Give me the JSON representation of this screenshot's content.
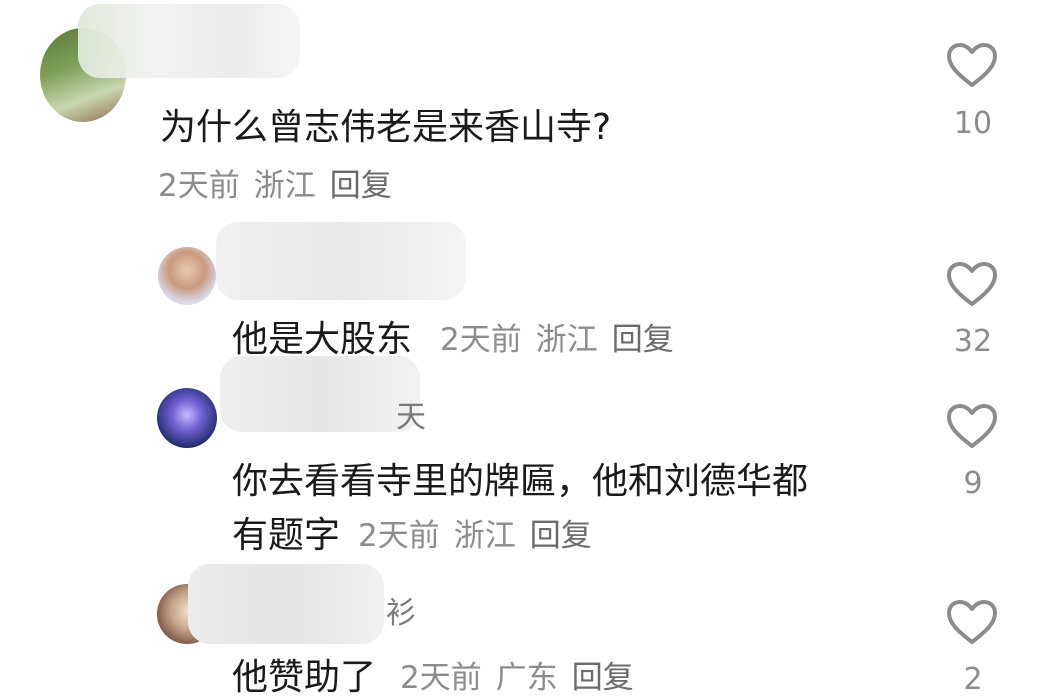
{
  "comments": [
    {
      "text": "为什么曾志伟老是来香山寺?",
      "time": "2天前",
      "location": "浙江",
      "reply_label": "回复",
      "likes": "10"
    },
    {
      "text": "他是大股东",
      "time": "2天前",
      "location": "浙江",
      "reply_label": "回复",
      "likes": "32"
    },
    {
      "username_partial": "天",
      "text_line1": "你去看看寺里的牌匾，他和刘德华都",
      "text_line2": "有题字",
      "time": "2天前",
      "location": "浙江",
      "reply_label": "回复",
      "likes": "9"
    },
    {
      "username_partial": "衫",
      "text": "他赞助了",
      "time": "2天前",
      "location": "广东",
      "reply_label": "回复",
      "likes": "2"
    }
  ],
  "icons": {
    "like": "heart-outline-icon"
  },
  "colors": {
    "text": "#1a1a1a",
    "meta": "#8c8c8c",
    "icon": "#8c8c8c"
  }
}
